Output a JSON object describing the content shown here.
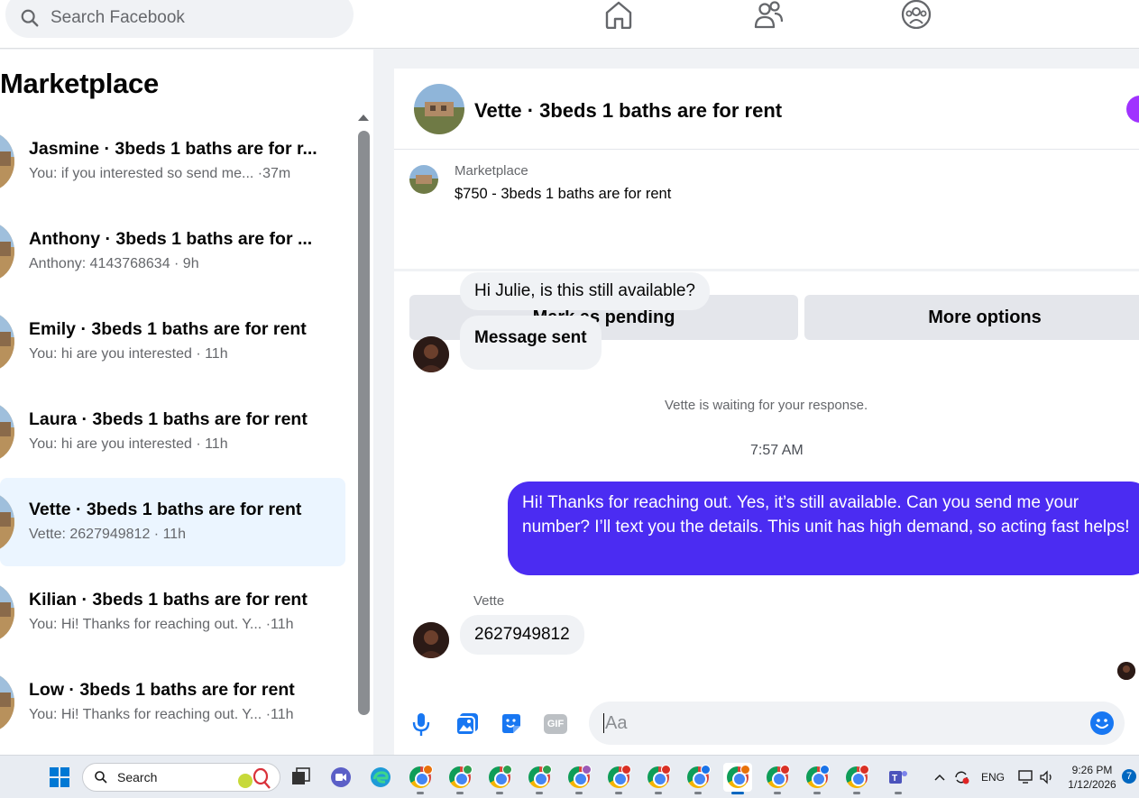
{
  "search": {
    "placeholder": "Search Facebook"
  },
  "nav": {
    "icons": [
      "home-icon",
      "friends-icon",
      "groups-icon"
    ]
  },
  "sidebar": {
    "title": "Marketplace",
    "threads": [
      {
        "title": "Jasmine · 3beds 1 baths are for r...",
        "sub": "You: if you interested so send me... ·37m",
        "active": false
      },
      {
        "title": "Anthony · 3beds 1 baths are for ...",
        "sub": "Anthony: 4143768634 · 9h",
        "active": false
      },
      {
        "title": "Emily · 3beds 1 baths are for rent",
        "sub": "You: hi are you interested · 11h",
        "active": false
      },
      {
        "title": "Laura · 3beds 1 baths are for rent",
        "sub": "You: hi are you interested · 11h",
        "active": false
      },
      {
        "title": "Vette · 3beds 1 baths are for rent",
        "sub": "Vette: 2627949812 · 11h",
        "active": true
      },
      {
        "title": "Kilian · 3beds 1 baths are for rent",
        "sub": "You: Hi! Thanks for reaching out. Y... ·11h",
        "active": false
      },
      {
        "title": "Low · 3beds 1 baths are for rent",
        "sub": "You: Hi! Thanks for reaching out. Y... ·11h",
        "active": false
      }
    ]
  },
  "chat": {
    "header_name": "Vette · 3beds 1 baths are for rent",
    "listing_source": "Marketplace",
    "listing_price_title": "$750 - 3beds 1 baths are for rent",
    "mark_pending_label": "Mark as pending",
    "more_options_label": "More options",
    "messages": {
      "msg1": "Hi Julie, is this still available?",
      "msg2": "Message sent",
      "waiting": "Vette is waiting for your response.",
      "time": "7:57 AM",
      "reply": "Hi! Thanks for reaching out. Yes, it’s still available. Can you send me your number? I’ll text you the details. This unit has high demand, so acting fast helps!",
      "sender": "Vette",
      "msg3": "2627949812"
    },
    "composer_placeholder": "Aa",
    "composer_icons": [
      "microphone-icon",
      "photo-icon",
      "sticker-icon",
      "gif-icon",
      "emoji-icon"
    ],
    "gif_label": "GIF"
  },
  "taskbar": {
    "search_label": "Search",
    "language": "ENG",
    "time": "9:26 PM",
    "date": "1/12/2026",
    "notifications": "7"
  },
  "colors": {
    "accent": "#4b2cf2",
    "active_thread": "#ebf5ff",
    "bubble_grey": "#f0f2f5",
    "facebook_blue": "#1877f2"
  }
}
